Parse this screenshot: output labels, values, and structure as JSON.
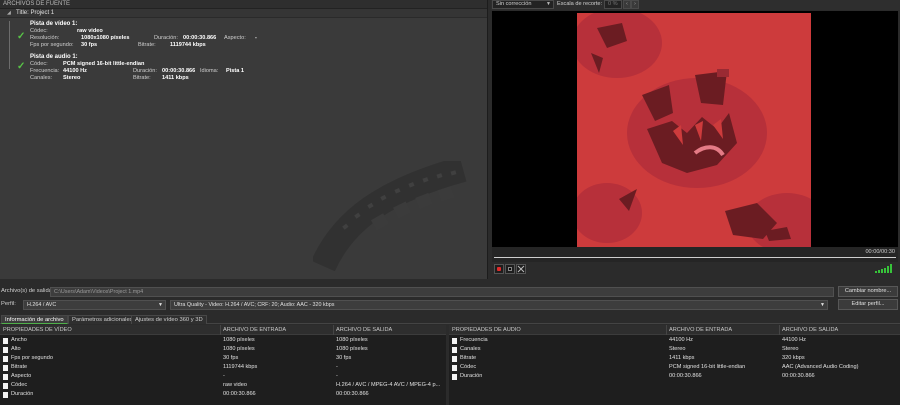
{
  "source_panel": {
    "header": "ARCHIVOS DE FUENTE",
    "project_title": "Title: Project 1",
    "video_stream": {
      "title": "Pista de vídeo 1:",
      "codec_label": "Códec:",
      "codec_value": "raw video",
      "resolution_label": "Resolución:",
      "resolution_value": "1080x1080 píxeles",
      "duration_label": "Duración:",
      "duration_value": "00:00:30.866",
      "aspect_label": "Aspecto:",
      "aspect_value": "-",
      "fps_label": "Fps por segundo:",
      "fps_value": "30 fps",
      "bitrate_label": "Bitrate:",
      "bitrate_value": "1119744 kbps"
    },
    "audio_stream": {
      "title": "Pista de audio 1:",
      "codec_label": "Códec:",
      "codec_value": "PCM signed 16-bit little-endian",
      "frequency_label": "Frecuencia:",
      "frequency_value": "44100 Hz",
      "duration_label": "Duración:",
      "duration_value": "00:00:30.866",
      "language_label": "Idioma:",
      "language_value": "Pista 1",
      "channels_label": "Canales:",
      "channels_value": "Stereo",
      "bitrate_label": "Bitrate:",
      "bitrate_value": "1411 kbps"
    }
  },
  "preview": {
    "correction_dropdown": "Sin corrección",
    "crop_scale_label": "Escala de recorte:",
    "crop_scale_value": "0 %",
    "time_readout": "00:00/00:30",
    "colors": {
      "frame_bg": "#cd3b3c",
      "frame_dark": "#6b1c22",
      "play_red": "#e02a2a",
      "volume_green": "#37c43a"
    }
  },
  "output": {
    "file_label": "Archivo(s) de salida:",
    "file_path": "C:\\Users\\Adam\\Videos\\Project 1.mp4",
    "change_name_button": "Cambiar nombre...",
    "profile_label": "Perfil:",
    "profile_value": "H.264 / AVC",
    "preset_value": "Ultra Quality - Video: H.264 / AVC; CRF: 20; Audio: AAC - 320 kbps",
    "edit_profile_button": "Editar perfil..."
  },
  "tabs": [
    {
      "label": "Información de archivo"
    },
    {
      "label": "Parámetros adicionales"
    },
    {
      "label": "Ajustes de vídeo 360 y 3D"
    }
  ],
  "video_props": {
    "headers": [
      "PROPIEDADES DE VÍDEO",
      "ARCHIVO DE ENTRADA",
      "ARCHIVO DE SALIDA"
    ],
    "rows": [
      {
        "name": "Ancho",
        "input": "1080 píxeles",
        "output": "1080 píxeles"
      },
      {
        "name": "Alto",
        "input": "1080 píxeles",
        "output": "1080 píxeles"
      },
      {
        "name": "Fps por segundo",
        "input": "30 fps",
        "output": "30 fps"
      },
      {
        "name": "Bitrate",
        "input": "1119744 kbps",
        "output": "-"
      },
      {
        "name": "Aspecto",
        "input": "-",
        "output": "-"
      },
      {
        "name": "Códec",
        "input": "raw video",
        "output": "H.264 / AVC / MPEG-4 AVC / MPEG-4 p..."
      },
      {
        "name": "Duración",
        "input": "00:00:30.866",
        "output": "00:00:30.866"
      }
    ]
  },
  "audio_props": {
    "headers": [
      "PROPIEDADES DE AUDIO",
      "ARCHIVO DE ENTRADA",
      "ARCHIVO DE SALIDA"
    ],
    "rows": [
      {
        "name": "Frecuencia",
        "input": "44100 Hz",
        "output": "44100 Hz"
      },
      {
        "name": "Canales",
        "input": "Stereo",
        "output": "Stereo"
      },
      {
        "name": "Bitrate",
        "input": "1411 kbps",
        "output": "320 kbps"
      },
      {
        "name": "Códec",
        "input": "PCM signed 16-bit little-endian",
        "output": "AAC (Advanced Audio Coding)"
      },
      {
        "name": "Duración",
        "input": "00:00:30.866",
        "output": "00:00:30.866"
      }
    ]
  }
}
